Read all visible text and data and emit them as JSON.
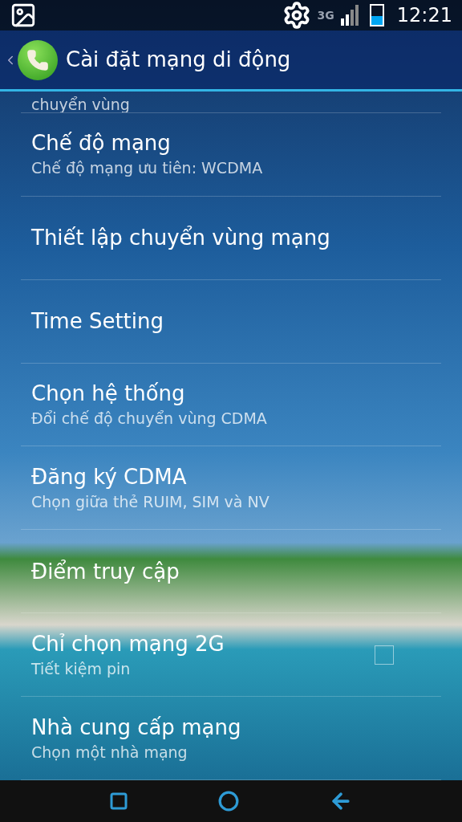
{
  "status_bar": {
    "network_type": "3G",
    "time": "12:21"
  },
  "action_bar": {
    "title": "Cài đặt mạng di động"
  },
  "partial_item": {
    "summary": "chuyển vùng"
  },
  "items": [
    {
      "kind": "text",
      "title": "Chế độ mạng",
      "summary": "Chế độ mạng ưu tiên: WCDMA"
    },
    {
      "kind": "text",
      "title": "Thiết lập chuyển vùng mạng"
    },
    {
      "kind": "text",
      "title": "Time Setting"
    },
    {
      "kind": "text",
      "title": "Chọn hệ thống",
      "summary": "Đổi chế độ chuyển vùng CDMA"
    },
    {
      "kind": "text",
      "title": "Đăng ký CDMA",
      "summary": "Chọn giữa thẻ RUIM, SIM và NV"
    },
    {
      "kind": "text",
      "title": "Điểm truy cập"
    },
    {
      "kind": "checkbox",
      "title": "Chỉ chọn mạng 2G",
      "summary": "Tiết kiệm pin",
      "checked": false
    },
    {
      "kind": "text",
      "title": "Nhà cung cấp mạng",
      "summary": "Chọn một nhà mạng"
    }
  ]
}
